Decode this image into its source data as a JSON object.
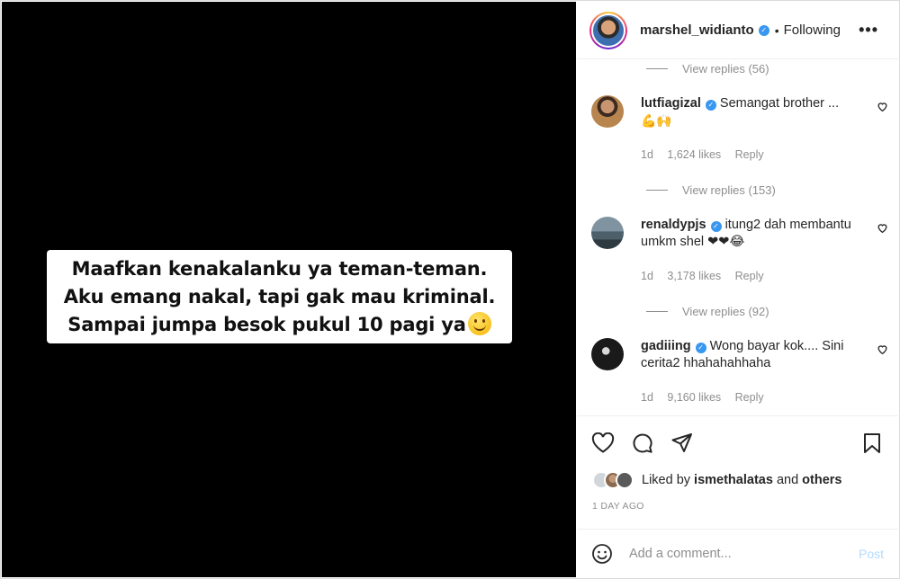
{
  "post": {
    "caption_lines": [
      "Maafkan kenakalanku ya teman-teman.",
      "Aku emang nakal, tapi gak mau kriminal.",
      "Sampai jumpa besok pukul 10 pagi ya"
    ],
    "caption_emoji": "smiling-face-emoji"
  },
  "header": {
    "username": "marshel_widianto",
    "separator": "•",
    "follow_status": "Following",
    "more_label": "•••"
  },
  "comments": {
    "view_replies": [
      "View replies (56)",
      "View replies (153)",
      "View replies (92)"
    ],
    "items": [
      {
        "username": "lutfiagizal",
        "text": "Semangat brother ...",
        "emoji_line": "💪🙌",
        "age": "1d",
        "likes": "1,624 likes",
        "reply": "Reply"
      },
      {
        "username": "renaldypjs",
        "text": "itung2 dah membantu umkm shel",
        "emoji_line": "❤❤😂",
        "age": "1d",
        "likes": "3,178 likes",
        "reply": "Reply"
      },
      {
        "username": "gadiiing",
        "text": "Wong bayar kok.... Sini cerita2 hhahahahhaha",
        "emoji_line": "",
        "age": "1d",
        "likes": "9,160 likes",
        "reply": "Reply"
      }
    ]
  },
  "footer": {
    "liked_by_prefix": "Liked by",
    "liked_by_user": "ismethalatas",
    "liked_by_and": "and",
    "liked_by_others": "others",
    "time_ago": "1 DAY AGO",
    "comment_placeholder": "Add a comment...",
    "post_label": "Post"
  },
  "colors": {
    "verified": "#3897f0",
    "muted": "#8e8e8e",
    "post_disabled": "#b3dbff"
  }
}
